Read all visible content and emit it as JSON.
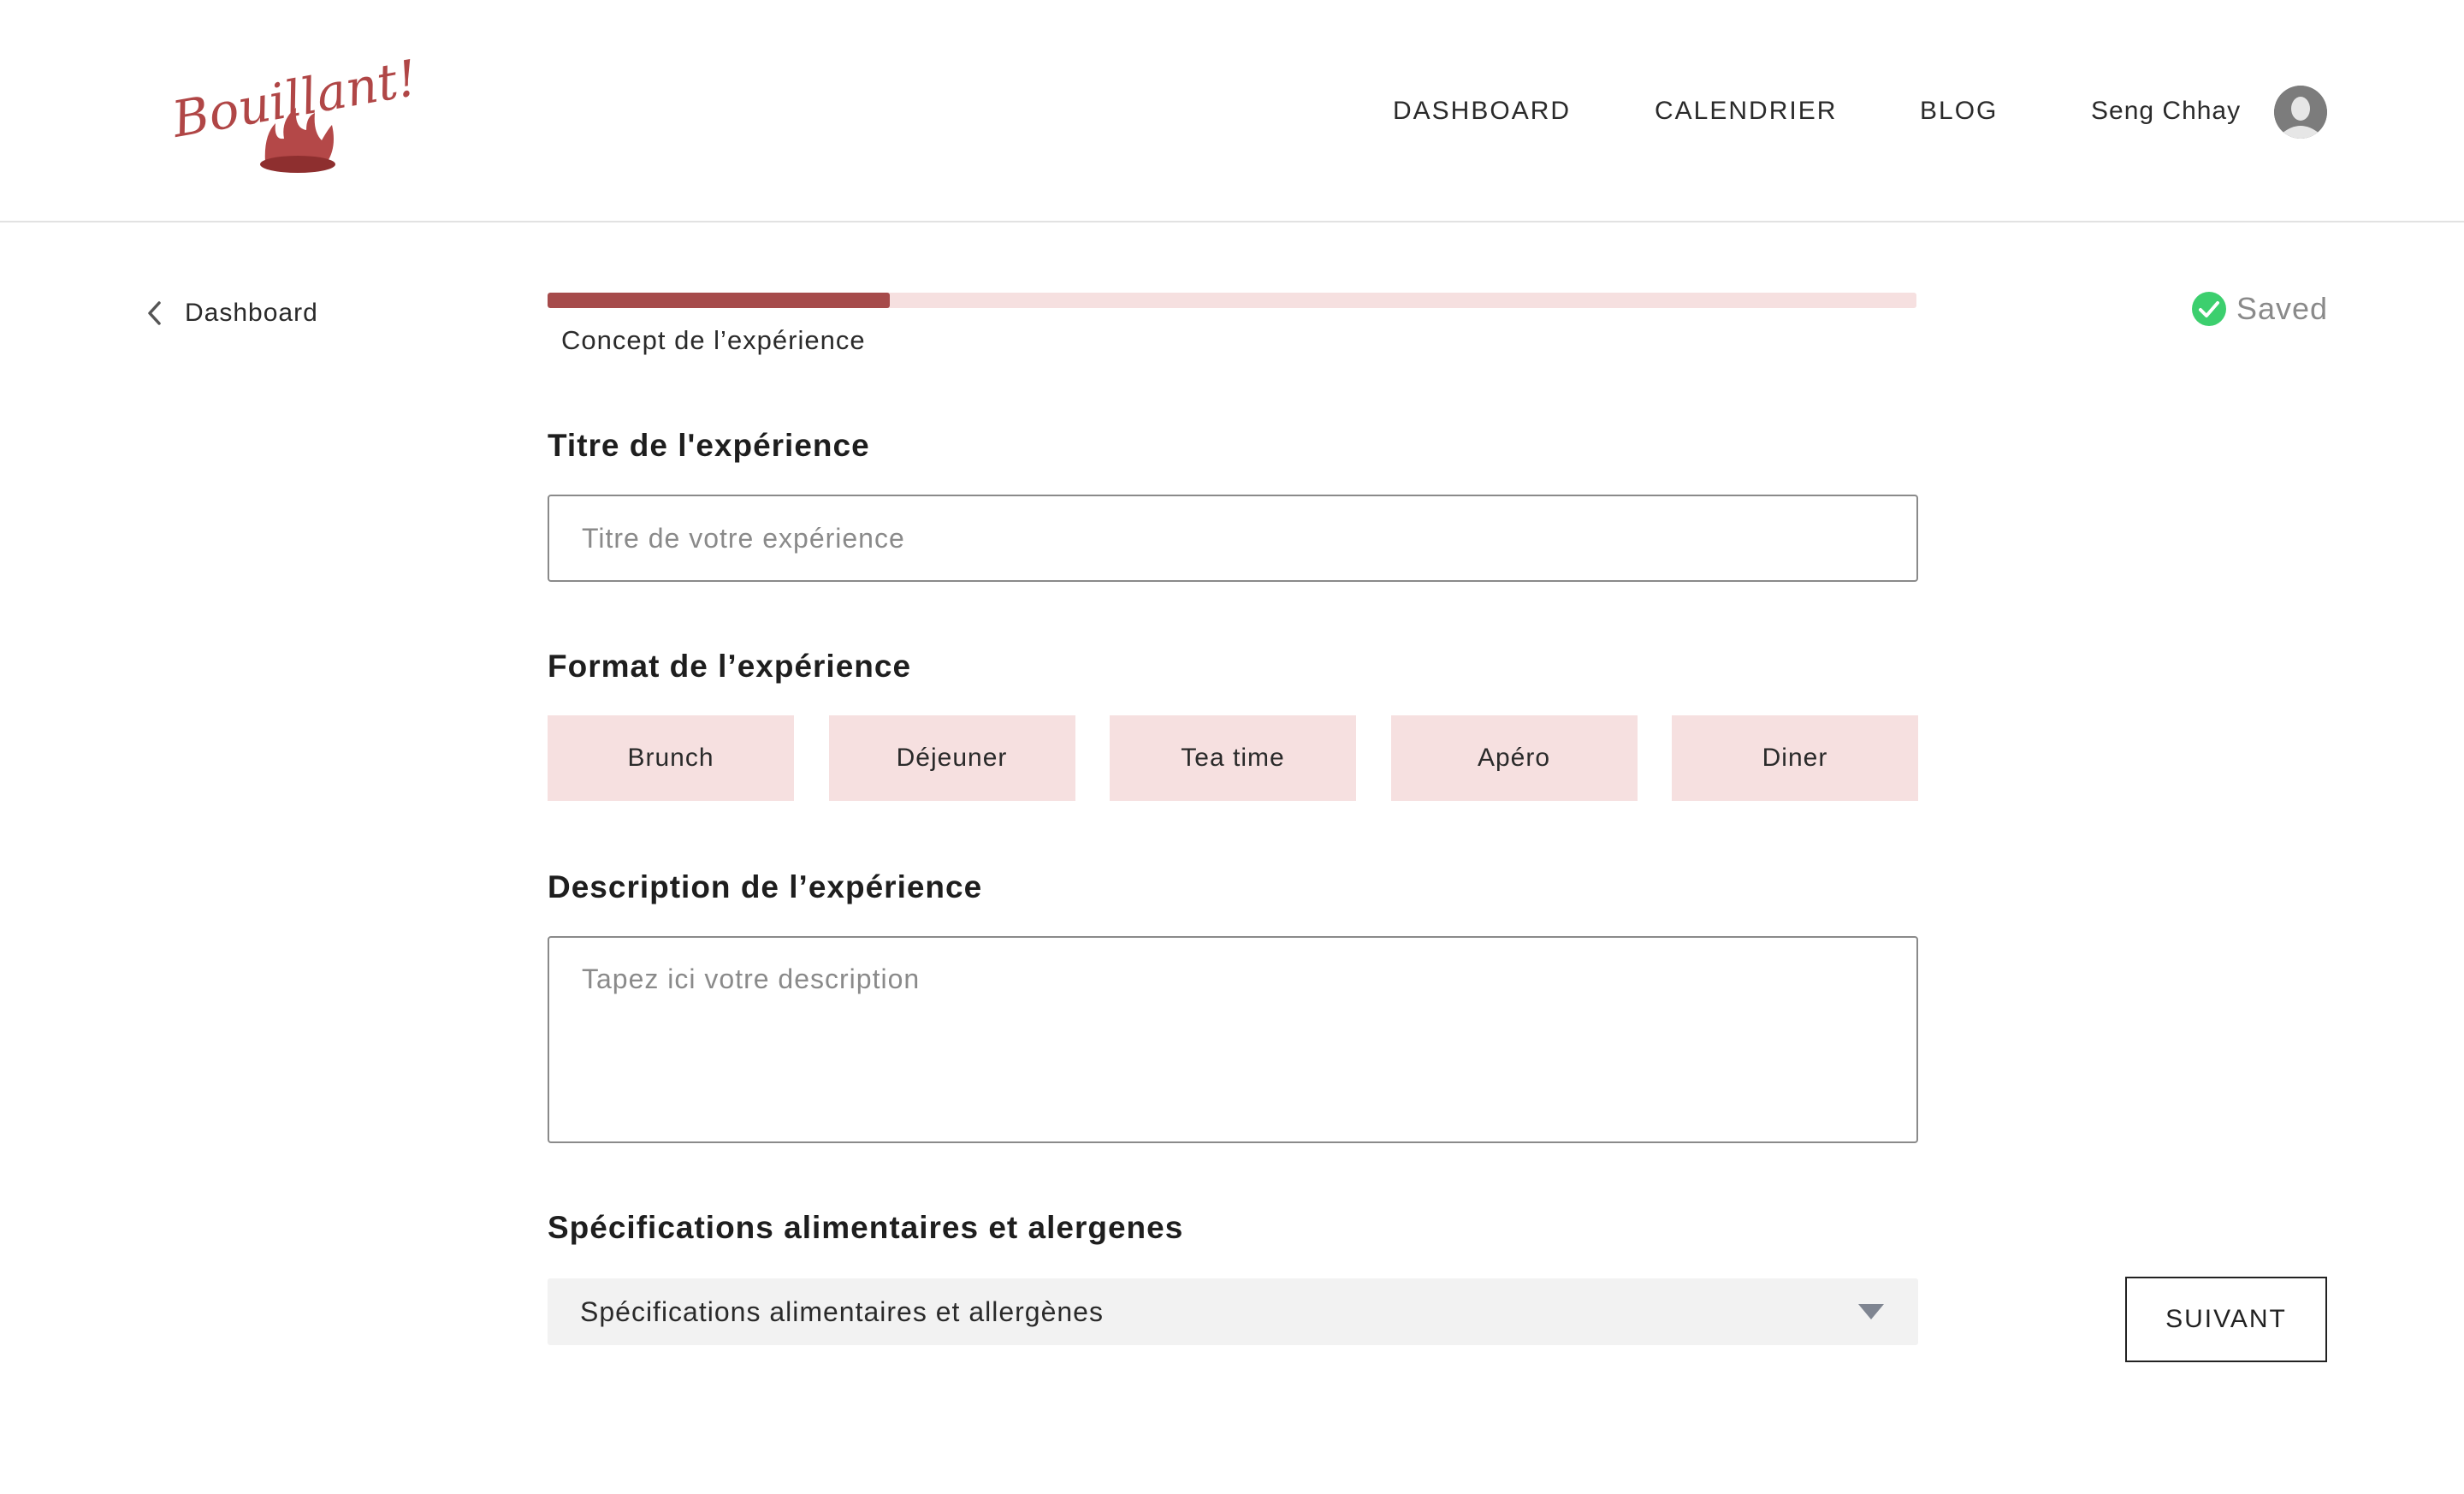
{
  "brand": {
    "logo_text": "Bouillant !",
    "accent": "#a64b4b",
    "accent_light": "#f6e0e0"
  },
  "nav": {
    "items": [
      "DASHBOARD",
      "CALENDRIER",
      "BLOG"
    ],
    "user_name": "Seng Chhay",
    "avatar_icon": "user-avatar-icon"
  },
  "back": {
    "icon": "chevron-left-icon",
    "label": "Dashboard"
  },
  "progress": {
    "value": 0.25,
    "step_label": "Concept de l’expérience"
  },
  "status": {
    "icon": "check-circle-icon",
    "label": "Saved",
    "color": "#3ccf6e"
  },
  "form": {
    "title_section": {
      "label": "Titre de l'expérience",
      "placeholder": "Titre de votre expérience",
      "value": ""
    },
    "format_section": {
      "label": "Format de l’expérience",
      "options": [
        "Brunch",
        "Déjeuner",
        "Tea time",
        "Apéro",
        "Diner"
      ]
    },
    "description_section": {
      "label": "Description de l’expérience",
      "placeholder": "Tapez ici votre description",
      "value": ""
    },
    "diet_section": {
      "label": "Spécifications alimentaires et alergenes",
      "selected": "Spécifications alimentaires et allergènes",
      "icon": "caret-down-icon"
    }
  },
  "actions": {
    "next_label": "SUIVANT"
  }
}
